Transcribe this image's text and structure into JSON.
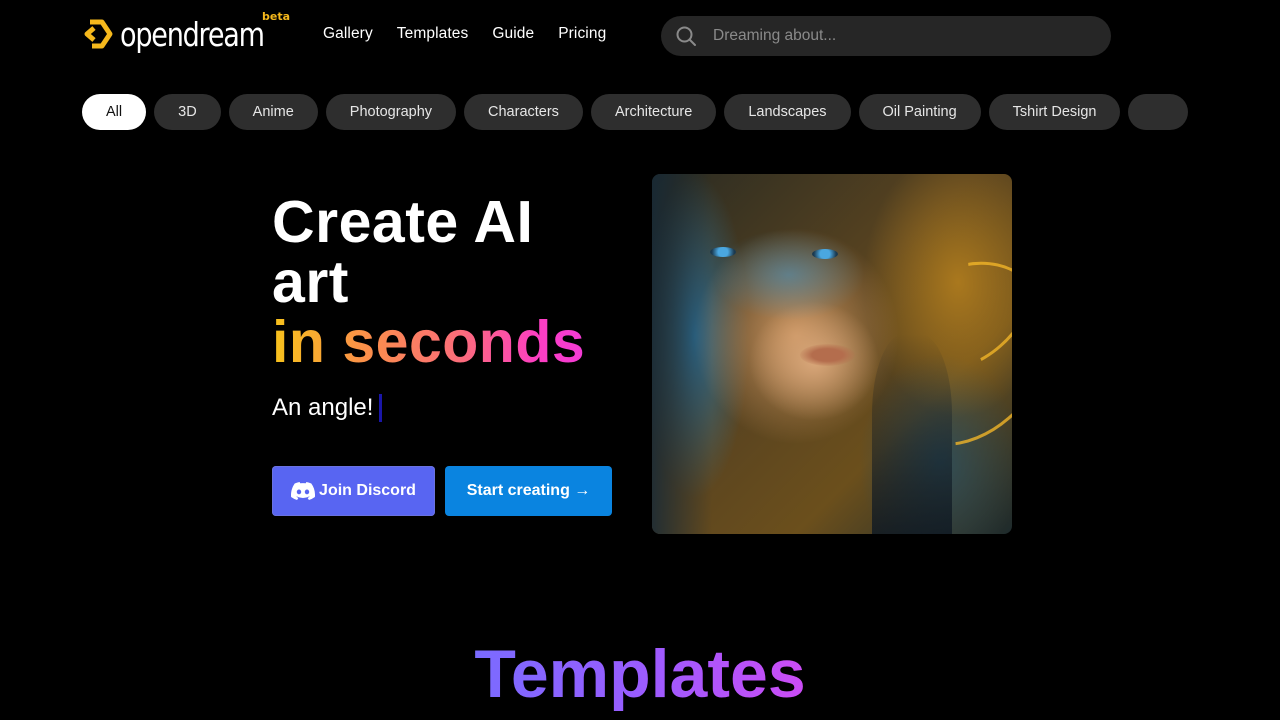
{
  "header": {
    "logo_text": "opendream",
    "logo_badge": "beta",
    "brand_color": "#f5b81c",
    "nav": [
      {
        "label": "Gallery"
      },
      {
        "label": "Templates"
      },
      {
        "label": "Guide"
      },
      {
        "label": "Pricing"
      }
    ],
    "search": {
      "placeholder": "Dreaming about...",
      "value": "",
      "icon": "search-icon"
    }
  },
  "categories": {
    "items": [
      {
        "label": "All",
        "active": true
      },
      {
        "label": "3D"
      },
      {
        "label": "Anime"
      },
      {
        "label": "Photography"
      },
      {
        "label": "Characters"
      },
      {
        "label": "Architecture"
      },
      {
        "label": "Landscapes"
      },
      {
        "label": "Oil Painting"
      },
      {
        "label": "Tshirt Design"
      },
      {
        "label": ""
      }
    ]
  },
  "hero": {
    "title_line1": "Create AI",
    "title_line2": "art",
    "title_line3": "in seconds",
    "typed_text": "An angle!",
    "discord_button": "Join Discord",
    "start_button": "Start creating →",
    "discord_color": "#5865f2",
    "start_color": "#0a84e0",
    "image_alt": "AI-generated portrait of a woman with blue eyes and golden flowing hair"
  },
  "templates_section": {
    "title": "Templates"
  }
}
